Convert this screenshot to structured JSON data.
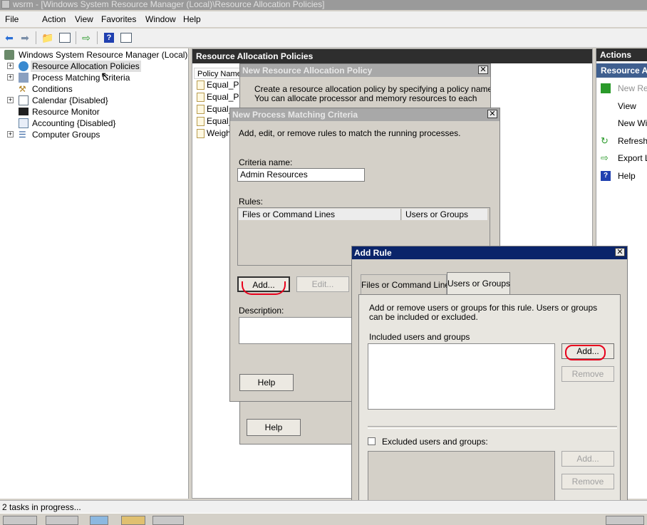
{
  "window": {
    "title": "wsrm - [Windows System Resource Manager (Local)\\Resource Allocation Policies]"
  },
  "menu": [
    "File",
    "Action",
    "View",
    "Favorites",
    "Window",
    "Help"
  ],
  "tree": {
    "root": "Windows System Resource Manager (Local)",
    "items": [
      {
        "label": "Resource Allocation Policies",
        "icon": "policy-globe-icon"
      },
      {
        "label": "Process Matching Criteria",
        "icon": "process-matching-icon"
      },
      {
        "label": "Conditions",
        "icon": "conditions-icon"
      },
      {
        "label": "Calendar  {Disabled}",
        "icon": "calendar-icon"
      },
      {
        "label": "Resource Monitor",
        "icon": "resource-monitor-icon"
      },
      {
        "label": "Accounting  {Disabled}",
        "icon": "accounting-icon"
      },
      {
        "label": "Computer Groups",
        "icon": "computer-groups-icon"
      }
    ]
  },
  "middle": {
    "header": "Resource Allocation Policies",
    "column": "Policy Name",
    "rows": [
      "Equal_Pe",
      "Equal_Pe",
      "Equal_",
      "Equal_",
      "Weigh"
    ]
  },
  "actions": {
    "header": "Actions",
    "subheader": "Resource A",
    "items": [
      "New Res",
      "View",
      "New Win",
      "Refresh",
      "Export Li",
      "Help"
    ]
  },
  "dlg_policy": {
    "title": "New Resource Allocation Policy",
    "desc_line1": "Create a resource allocation policy by specifying a policy name.",
    "desc_line2": "You can allocate processor and memory resources to each",
    "help": "Help"
  },
  "dlg_criteria": {
    "title": "New Process Matching Criteria",
    "intro": "Add, edit, or remove rules to match the running processes.",
    "criteria_label": "Criteria name:",
    "criteria_value": "Admin Resources",
    "rules_label": "Rules:",
    "col_files": "Files or Command Lines",
    "col_users": "Users or Groups",
    "add": "Add...",
    "edit": "Edit...",
    "description_label": "Description:",
    "help": "Help"
  },
  "dlg_rule": {
    "title": "Add Rule",
    "tab_files": "Files or Command Lines",
    "tab_users": "Users or Groups",
    "intro": "Add or remove users or groups for this rule. Users or groups can be included or excluded.",
    "included_label": "Included users and groups",
    "add": "Add...",
    "remove": "Remove",
    "excluded_label": "Excluded users and groups:",
    "add2": "Add...",
    "remove2": "Remove"
  },
  "status": "2 tasks in progress..."
}
